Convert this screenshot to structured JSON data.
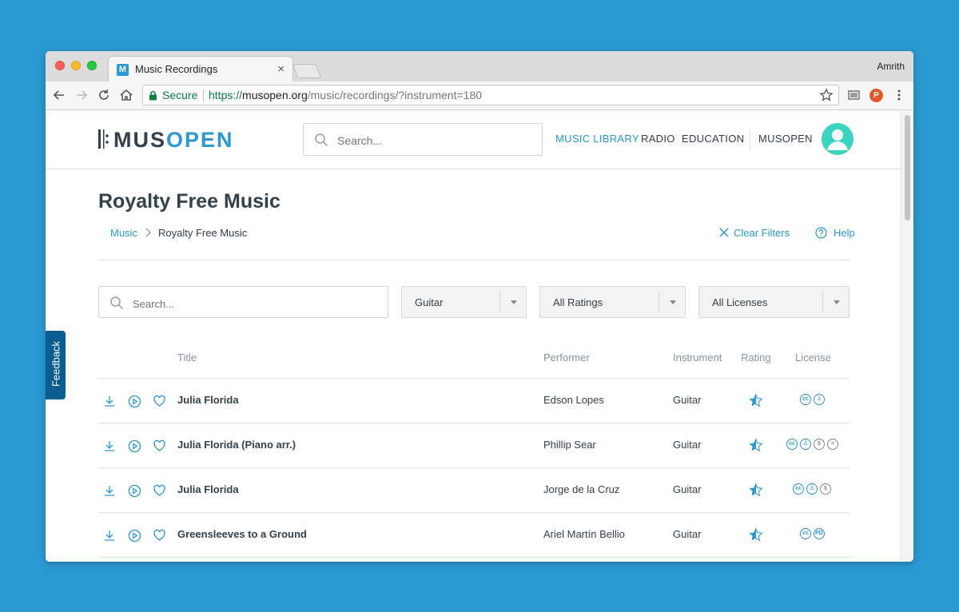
{
  "browser": {
    "tab_title": "Music Recordings",
    "tab_favicon": "M",
    "tab_close": "×",
    "profile_name": "Amrith",
    "secure_label": "Secure",
    "url_scheme": "https://",
    "url_host": "musopen.org",
    "url_path": "/music/recordings/?instrument=180",
    "profile_badge": "P"
  },
  "header": {
    "logo_mus": "MUS",
    "logo_open": "OPEN",
    "search_placeholder": "Search...",
    "nav": [
      "MUSIC LIBRARY",
      "RADIO",
      "EDUCATION",
      "MUSOPEN"
    ],
    "accent_color": "#2a98d1",
    "avatar_color": "#3ad4c1"
  },
  "main": {
    "title": "Royalty Free Music",
    "breadcrumb": [
      "Music",
      "Royalty Free Music"
    ],
    "clear_filters": "Clear Filters",
    "help": "Help"
  },
  "filters": {
    "search_placeholder": "Search...",
    "instrument": "Guitar",
    "ratings": "All Ratings",
    "licenses": "All Licenses"
  },
  "table": {
    "headers": [
      "Title",
      "Performer",
      "Instrument",
      "Rating",
      "License"
    ],
    "rows": [
      {
        "title": "Julia Florida",
        "performer": "Edson Lopes",
        "instrument": "Guitar",
        "license": [
          "cc",
          "by"
        ]
      },
      {
        "title": "Julia Florida (Piano arr.)",
        "performer": "Phillip Sear",
        "instrument": "Guitar",
        "license": [
          "cc",
          "by",
          "nc",
          "nd"
        ]
      },
      {
        "title": "Julia Florida",
        "performer": "Jorge de la Cruz",
        "instrument": "Guitar",
        "license": [
          "cc",
          "by",
          "nc"
        ]
      },
      {
        "title": "Greensleeves to a Ground",
        "performer": "Ariel Martín Bellio",
        "instrument": "Guitar",
        "license": [
          "cc",
          "pd"
        ]
      }
    ]
  },
  "feedback": "Feedback"
}
